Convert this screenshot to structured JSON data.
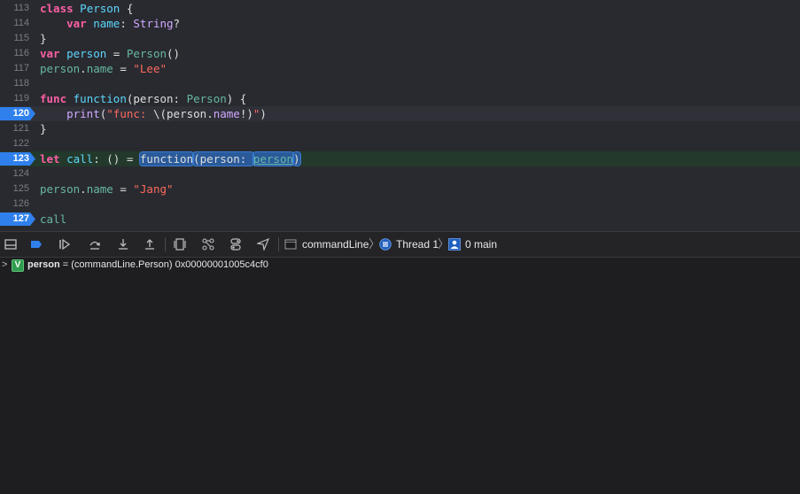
{
  "editor": {
    "lines": [
      {
        "num": "113",
        "tokens": [
          {
            "t": "class",
            "c": "kw"
          },
          {
            "t": " ",
            "c": "pl"
          },
          {
            "t": "Person",
            "c": "ty"
          },
          {
            "t": " {",
            "c": "pl"
          }
        ]
      },
      {
        "num": "114",
        "tokens": [
          {
            "t": "    ",
            "c": "pl"
          },
          {
            "t": "var",
            "c": "kw"
          },
          {
            "t": " ",
            "c": "pl"
          },
          {
            "t": "name",
            "c": "ty"
          },
          {
            "t": ": ",
            "c": "pl"
          },
          {
            "t": "String",
            "c": "tr"
          },
          {
            "t": "?",
            "c": "pl"
          }
        ]
      },
      {
        "num": "115",
        "tokens": [
          {
            "t": "}",
            "c": "pl"
          }
        ]
      },
      {
        "num": "116",
        "tokens": [
          {
            "t": "var",
            "c": "kw"
          },
          {
            "t": " ",
            "c": "pl"
          },
          {
            "t": "person",
            "c": "ty"
          },
          {
            "t": " = ",
            "c": "pl"
          },
          {
            "t": "Person",
            "c": "fn"
          },
          {
            "t": "()",
            "c": "pl"
          }
        ]
      },
      {
        "num": "117",
        "tokens": [
          {
            "t": "person",
            "c": "fn"
          },
          {
            "t": ".",
            "c": "pl"
          },
          {
            "t": "name",
            "c": "fn"
          },
          {
            "t": " = ",
            "c": "pl"
          },
          {
            "t": "\"Lee\"",
            "c": "st"
          }
        ]
      },
      {
        "num": "118",
        "tokens": []
      },
      {
        "num": "119",
        "tokens": [
          {
            "t": "func",
            "c": "kw"
          },
          {
            "t": " ",
            "c": "pl"
          },
          {
            "t": "function",
            "c": "ty"
          },
          {
            "t": "(person: ",
            "c": "pl"
          },
          {
            "t": "Person",
            "c": "fn"
          },
          {
            "t": ") {",
            "c": "pl"
          }
        ]
      },
      {
        "num": "120",
        "breakpoint": true,
        "hl": "bp",
        "tokens": [
          {
            "t": "    ",
            "c": "pl"
          },
          {
            "t": "print",
            "c": "tr"
          },
          {
            "t": "(",
            "c": "pl"
          },
          {
            "t": "\"func: ",
            "c": "st"
          },
          {
            "t": "\\(",
            "c": "pl"
          },
          {
            "t": "person",
            "c": "pl"
          },
          {
            "t": ".",
            "c": "pl"
          },
          {
            "t": "name",
            "c": "tr"
          },
          {
            "t": "!)",
            "c": "pl"
          },
          {
            "t": "\"",
            "c": "st"
          },
          {
            "t": ")",
            "c": "pl"
          }
        ]
      },
      {
        "num": "121",
        "tokens": [
          {
            "t": "}",
            "c": "pl"
          }
        ]
      },
      {
        "num": "122",
        "tokens": []
      },
      {
        "num": "123",
        "breakpoint": true,
        "hl": "cur",
        "tokens": [
          {
            "t": "let",
            "c": "kw"
          },
          {
            "t": " ",
            "c": "pl"
          },
          {
            "t": "call",
            "c": "ty"
          },
          {
            "t": ": () = ",
            "c": "pl"
          },
          {
            "t": "function",
            "c": "pl sel"
          },
          {
            "t": "(person: ",
            "c": "pl sel"
          },
          {
            "t": "person",
            "c": "und sel"
          },
          {
            "t": ")",
            "c": "pl sel"
          }
        ]
      },
      {
        "num": "124",
        "tokens": []
      },
      {
        "num": "125",
        "tokens": [
          {
            "t": "person",
            "c": "fn"
          },
          {
            "t": ".",
            "c": "pl"
          },
          {
            "t": "name",
            "c": "fn"
          },
          {
            "t": " = ",
            "c": "pl"
          },
          {
            "t": "\"Jang\"",
            "c": "st"
          }
        ]
      },
      {
        "num": "126",
        "tokens": []
      },
      {
        "num": "127",
        "breakpoint": true,
        "tokens": [
          {
            "t": "call",
            "c": "fn"
          }
        ]
      }
    ]
  },
  "debug_bar": {
    "icons": [
      "hide-debug-area-icon",
      "breakpoints-toggle-icon",
      "continue-icon",
      "step-over-icon",
      "step-into-icon",
      "step-out-icon",
      "view-hierarchy-icon",
      "memory-graph-icon",
      "environment-overrides-icon",
      "simulate-location-icon"
    ],
    "process": "commandLine",
    "thread": "Thread 1",
    "frame": "0 main"
  },
  "variables": [
    {
      "badge": "V",
      "name": "person",
      "value": " = (commandLine.Person) 0x00000001005c4cf0"
    }
  ]
}
